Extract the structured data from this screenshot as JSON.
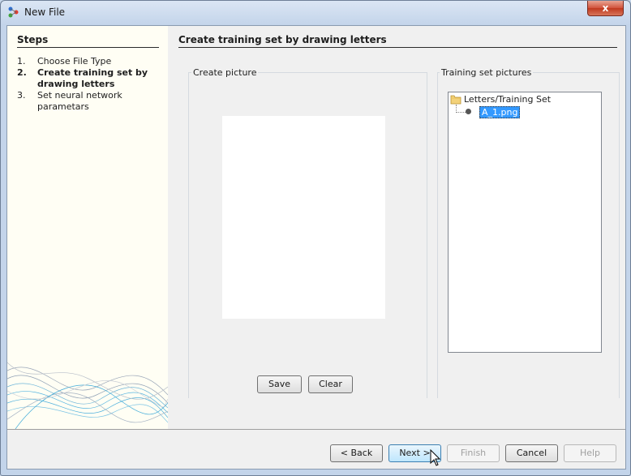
{
  "window": {
    "title": "New File",
    "close_glyph": "x"
  },
  "steps": {
    "header": "Steps",
    "items": [
      {
        "num": "1.",
        "label": "Choose File Type",
        "current": false
      },
      {
        "num": "2.",
        "label": "Create training set by drawing letters",
        "current": true
      },
      {
        "num": "3.",
        "label": "Set neural network parametars",
        "current": false
      }
    ]
  },
  "main": {
    "header": "Create training set by drawing letters",
    "create_picture": {
      "label": "Create picture",
      "save_label": "Save",
      "clear_label": "Clear"
    },
    "training_set": {
      "label": "Training set pictures",
      "root": "Letters/Training Set",
      "items": [
        "A_1.png"
      ]
    }
  },
  "footer": {
    "back_label": "< Back",
    "next_label": "Next >",
    "finish_label": "Finish",
    "cancel_label": "Cancel",
    "help_label": "Help"
  },
  "colors": {
    "selection": "#3399ff",
    "left_panel_bg": "#fffef4",
    "dialog_bg": "#f0f0f0"
  },
  "icons": [
    "app-icon",
    "close-icon",
    "folder-icon",
    "file-node-icon",
    "mouse-cursor-icon"
  ]
}
